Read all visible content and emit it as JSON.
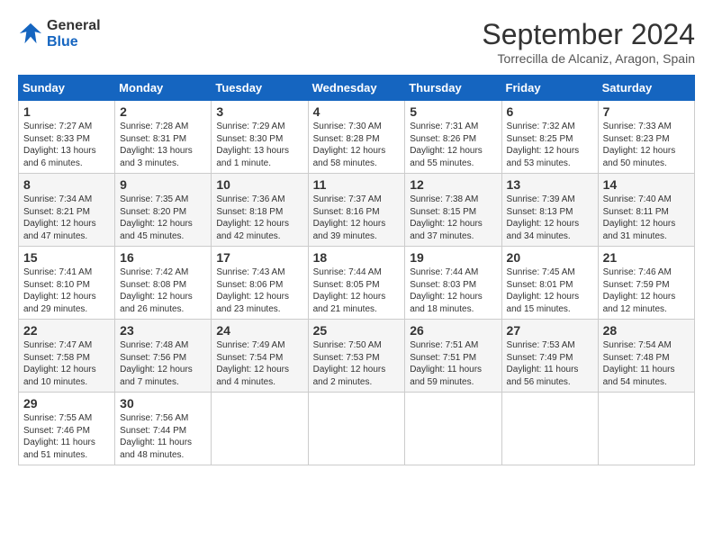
{
  "logo": {
    "general": "General",
    "blue": "Blue"
  },
  "header": {
    "month": "September 2024",
    "location": "Torrecilla de Alcaniz, Aragon, Spain"
  },
  "weekdays": [
    "Sunday",
    "Monday",
    "Tuesday",
    "Wednesday",
    "Thursday",
    "Friday",
    "Saturday"
  ],
  "weeks": [
    [
      {
        "day": "1",
        "sunrise": "7:27 AM",
        "sunset": "8:33 PM",
        "daylight": "13 hours and 6 minutes."
      },
      {
        "day": "2",
        "sunrise": "7:28 AM",
        "sunset": "8:31 PM",
        "daylight": "13 hours and 3 minutes."
      },
      {
        "day": "3",
        "sunrise": "7:29 AM",
        "sunset": "8:30 PM",
        "daylight": "13 hours and 1 minute."
      },
      {
        "day": "4",
        "sunrise": "7:30 AM",
        "sunset": "8:28 PM",
        "daylight": "12 hours and 58 minutes."
      },
      {
        "day": "5",
        "sunrise": "7:31 AM",
        "sunset": "8:26 PM",
        "daylight": "12 hours and 55 minutes."
      },
      {
        "day": "6",
        "sunrise": "7:32 AM",
        "sunset": "8:25 PM",
        "daylight": "12 hours and 53 minutes."
      },
      {
        "day": "7",
        "sunrise": "7:33 AM",
        "sunset": "8:23 PM",
        "daylight": "12 hours and 50 minutes."
      }
    ],
    [
      {
        "day": "8",
        "sunrise": "7:34 AM",
        "sunset": "8:21 PM",
        "daylight": "12 hours and 47 minutes."
      },
      {
        "day": "9",
        "sunrise": "7:35 AM",
        "sunset": "8:20 PM",
        "daylight": "12 hours and 45 minutes."
      },
      {
        "day": "10",
        "sunrise": "7:36 AM",
        "sunset": "8:18 PM",
        "daylight": "12 hours and 42 minutes."
      },
      {
        "day": "11",
        "sunrise": "7:37 AM",
        "sunset": "8:16 PM",
        "daylight": "12 hours and 39 minutes."
      },
      {
        "day": "12",
        "sunrise": "7:38 AM",
        "sunset": "8:15 PM",
        "daylight": "12 hours and 37 minutes."
      },
      {
        "day": "13",
        "sunrise": "7:39 AM",
        "sunset": "8:13 PM",
        "daylight": "12 hours and 34 minutes."
      },
      {
        "day": "14",
        "sunrise": "7:40 AM",
        "sunset": "8:11 PM",
        "daylight": "12 hours and 31 minutes."
      }
    ],
    [
      {
        "day": "15",
        "sunrise": "7:41 AM",
        "sunset": "8:10 PM",
        "daylight": "12 hours and 29 minutes."
      },
      {
        "day": "16",
        "sunrise": "7:42 AM",
        "sunset": "8:08 PM",
        "daylight": "12 hours and 26 minutes."
      },
      {
        "day": "17",
        "sunrise": "7:43 AM",
        "sunset": "8:06 PM",
        "daylight": "12 hours and 23 minutes."
      },
      {
        "day": "18",
        "sunrise": "7:44 AM",
        "sunset": "8:05 PM",
        "daylight": "12 hours and 21 minutes."
      },
      {
        "day": "19",
        "sunrise": "7:44 AM",
        "sunset": "8:03 PM",
        "daylight": "12 hours and 18 minutes."
      },
      {
        "day": "20",
        "sunrise": "7:45 AM",
        "sunset": "8:01 PM",
        "daylight": "12 hours and 15 minutes."
      },
      {
        "day": "21",
        "sunrise": "7:46 AM",
        "sunset": "7:59 PM",
        "daylight": "12 hours and 12 minutes."
      }
    ],
    [
      {
        "day": "22",
        "sunrise": "7:47 AM",
        "sunset": "7:58 PM",
        "daylight": "12 hours and 10 minutes."
      },
      {
        "day": "23",
        "sunrise": "7:48 AM",
        "sunset": "7:56 PM",
        "daylight": "12 hours and 7 minutes."
      },
      {
        "day": "24",
        "sunrise": "7:49 AM",
        "sunset": "7:54 PM",
        "daylight": "12 hours and 4 minutes."
      },
      {
        "day": "25",
        "sunrise": "7:50 AM",
        "sunset": "7:53 PM",
        "daylight": "12 hours and 2 minutes."
      },
      {
        "day": "26",
        "sunrise": "7:51 AM",
        "sunset": "7:51 PM",
        "daylight": "11 hours and 59 minutes."
      },
      {
        "day": "27",
        "sunrise": "7:53 AM",
        "sunset": "7:49 PM",
        "daylight": "11 hours and 56 minutes."
      },
      {
        "day": "28",
        "sunrise": "7:54 AM",
        "sunset": "7:48 PM",
        "daylight": "11 hours and 54 minutes."
      }
    ],
    [
      {
        "day": "29",
        "sunrise": "7:55 AM",
        "sunset": "7:46 PM",
        "daylight": "11 hours and 51 minutes."
      },
      {
        "day": "30",
        "sunrise": "7:56 AM",
        "sunset": "7:44 PM",
        "daylight": "11 hours and 48 minutes."
      },
      null,
      null,
      null,
      null,
      null
    ]
  ]
}
